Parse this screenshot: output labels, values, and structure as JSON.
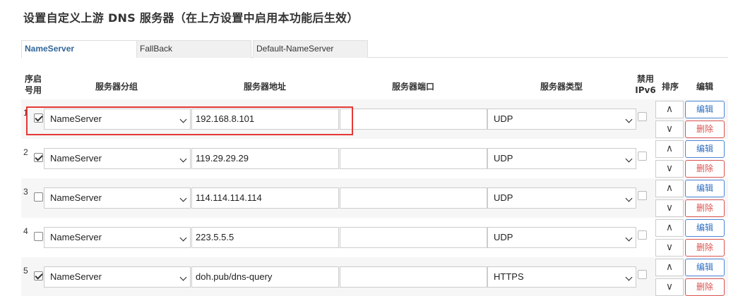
{
  "page": {
    "title": "设置自定义上游 DNS 服务器（在上方设置中启用本功能后生效）",
    "tabs": [
      {
        "label": "NameServer",
        "active": true
      },
      {
        "label": "FallBack",
        "active": false
      },
      {
        "label": "Default-NameServer",
        "active": false
      }
    ]
  },
  "columns": {
    "seq_enable": "序启\n号用",
    "group": "服务器分组",
    "address": "服务器地址",
    "port": "服务器端口",
    "type": "服务器类型",
    "disable_ipv6": "禁用\nIPv6",
    "sort": "排序",
    "edit": "编辑"
  },
  "buttons": {
    "up": "∧",
    "down": "∨",
    "edit": "编辑",
    "delete": "删除"
  },
  "rows": [
    {
      "index": "1",
      "enabled": true,
      "group": "NameServer",
      "address": "192.168.8.101",
      "port": "",
      "type": "UDP",
      "disable_ipv6": false
    },
    {
      "index": "2",
      "enabled": true,
      "group": "NameServer",
      "address": "119.29.29.29",
      "port": "",
      "type": "UDP",
      "disable_ipv6": false
    },
    {
      "index": "3",
      "enabled": false,
      "group": "NameServer",
      "address": "114.114.114.114",
      "port": "",
      "type": "UDP",
      "disable_ipv6": false
    },
    {
      "index": "4",
      "enabled": false,
      "group": "NameServer",
      "address": "223.5.5.5",
      "port": "",
      "type": "UDP",
      "disable_ipv6": false
    },
    {
      "index": "5",
      "enabled": true,
      "group": "NameServer",
      "address": "doh.pub/dns-query",
      "port": "",
      "type": "HTTPS",
      "disable_ipv6": false
    }
  ],
  "colors": {
    "accent": "#336699",
    "edit_button": "#2f6fc2",
    "delete_button": "#d9534f",
    "highlight": "#e53935"
  }
}
